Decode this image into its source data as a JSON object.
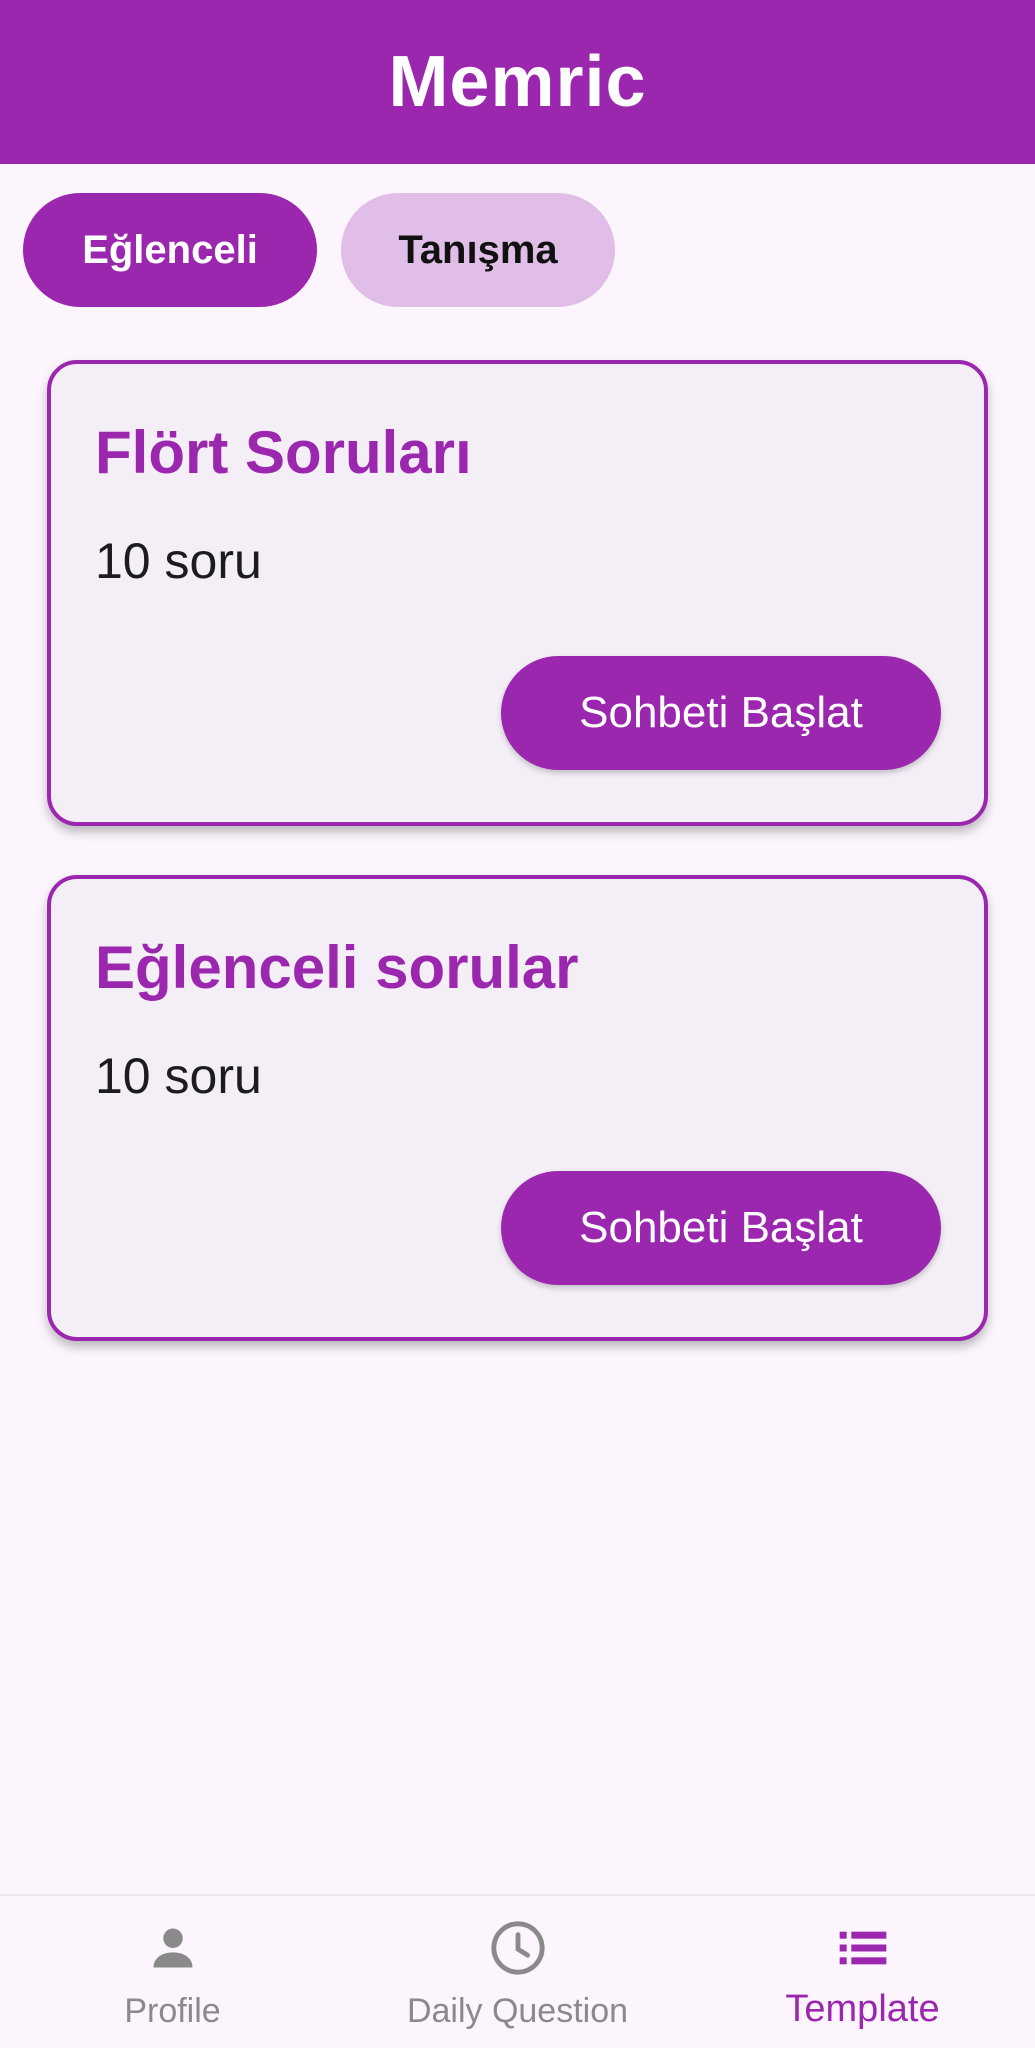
{
  "app_bar": {
    "title": "Memric"
  },
  "chips": [
    {
      "label": "Eğlenceli",
      "selected": true
    },
    {
      "label": "Tanışma",
      "selected": false
    }
  ],
  "cards": [
    {
      "title": "Flört Soruları",
      "count": "10 soru",
      "button": "Sohbeti Başlat"
    },
    {
      "title": "Eğlenceli sorular",
      "count": "10 soru",
      "button": "Sohbeti Başlat"
    }
  ],
  "bottom_nav": {
    "items": [
      {
        "label": "Profile",
        "icon": "person-icon",
        "active": false
      },
      {
        "label": "Daily Question",
        "icon": "clock-icon",
        "active": false
      },
      {
        "label": "Template",
        "icon": "list-icon",
        "active": true
      }
    ]
  },
  "colors": {
    "primary": "#9b27af",
    "chip_unselected": "#e1bee7",
    "background": "#fcf5fd",
    "card_background": "#f4eff7",
    "nav_inactive": "#8a8a8a"
  }
}
